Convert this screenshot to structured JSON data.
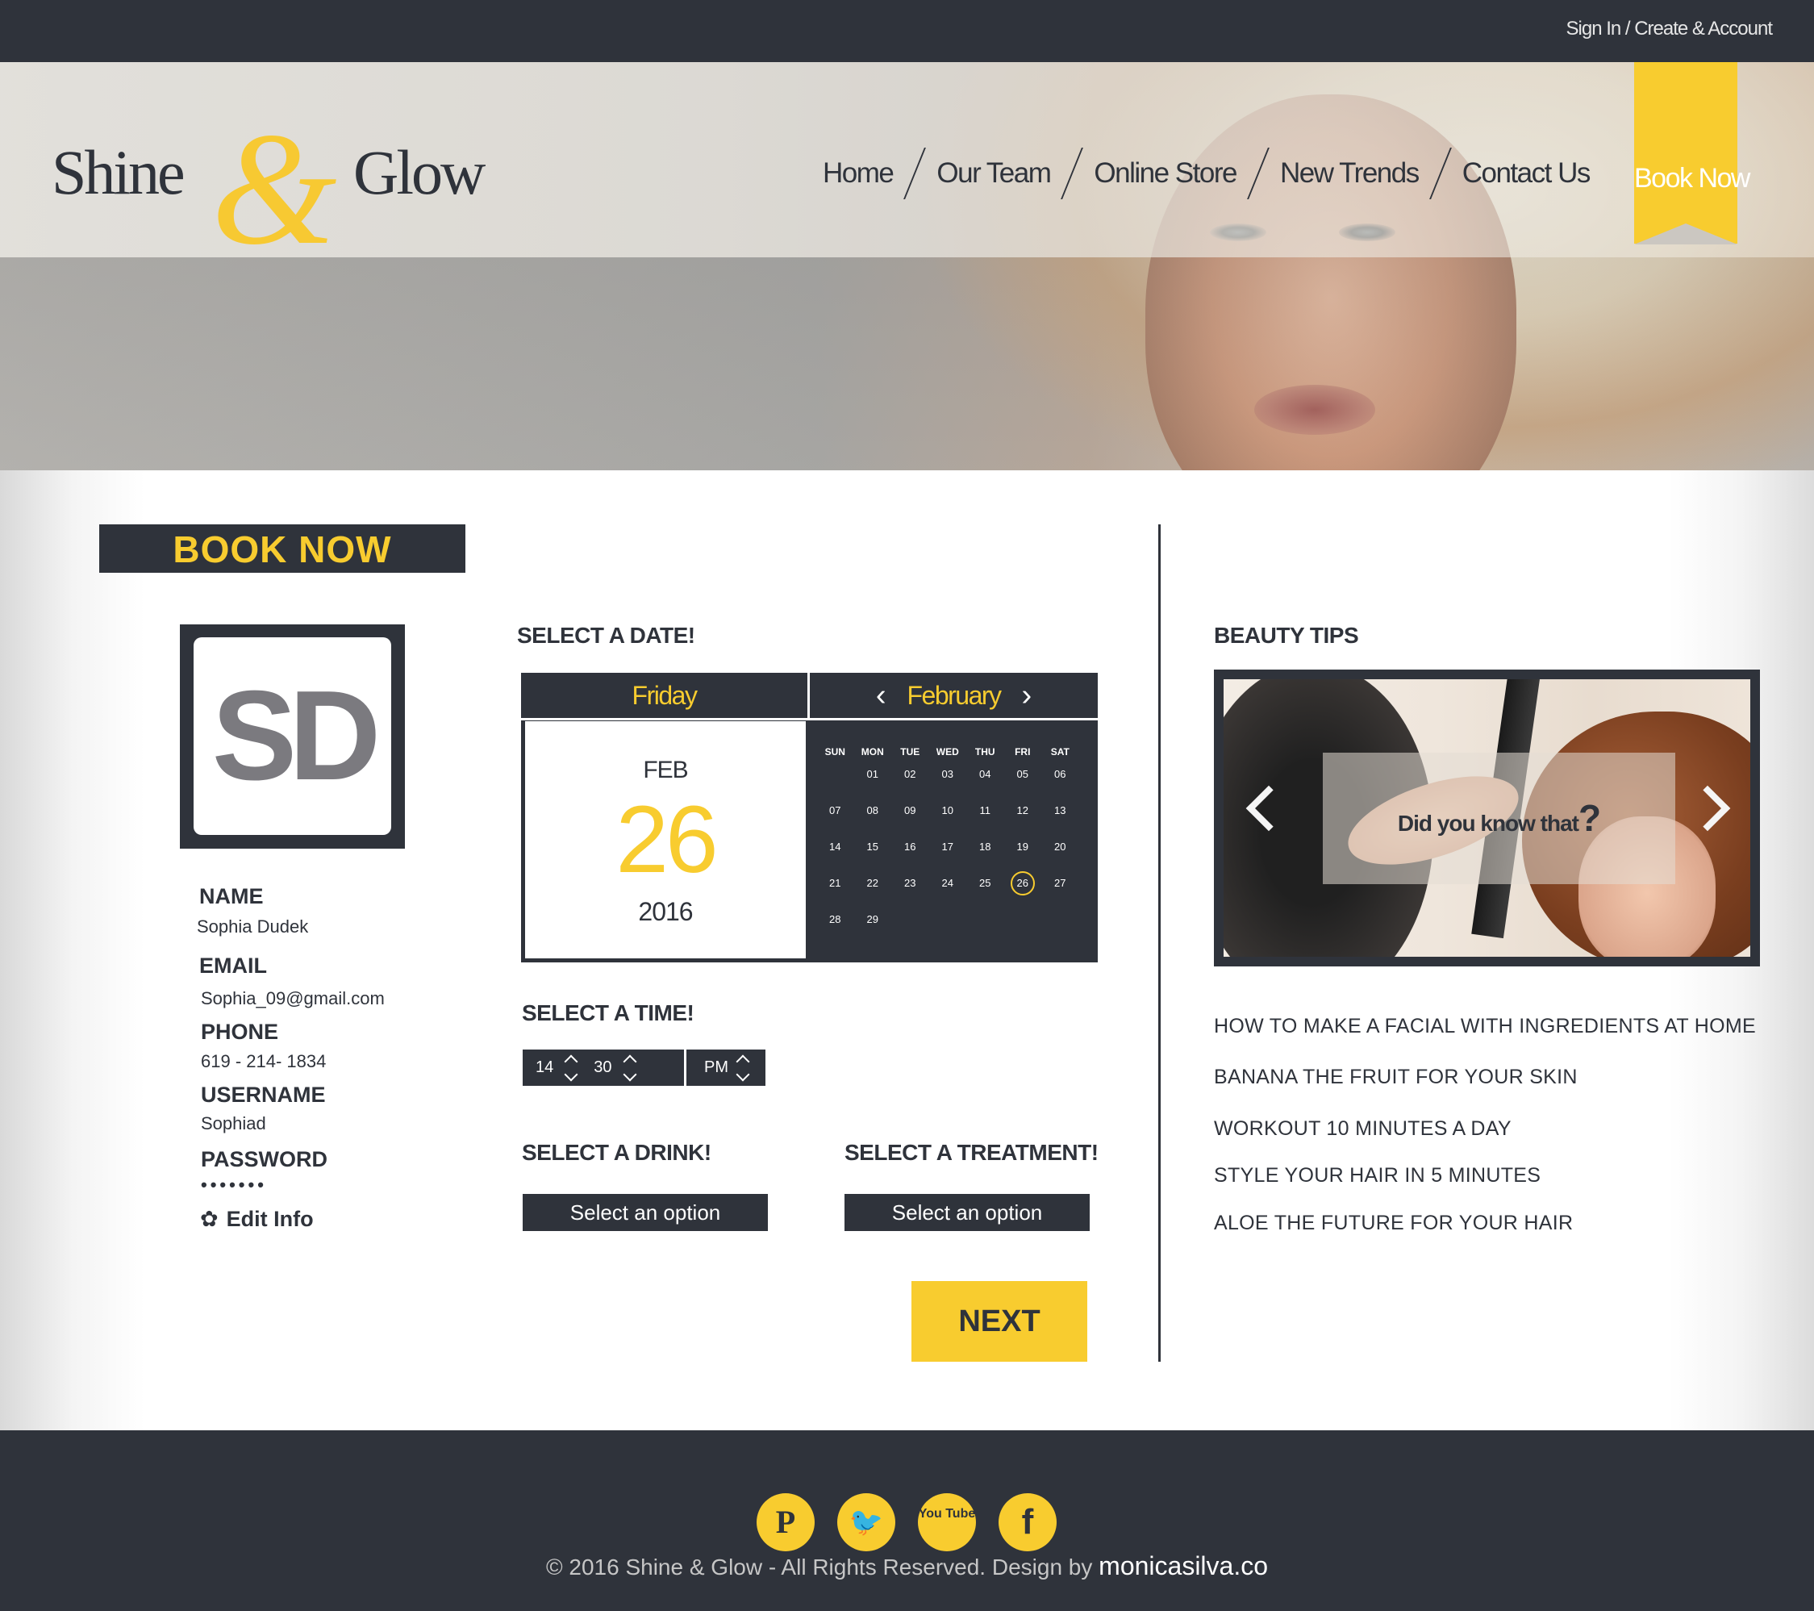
{
  "topbar": {
    "signin": "Sign In / Create & Account"
  },
  "logo": {
    "word1": "Shine",
    "amp": "&",
    "word2": "Glow"
  },
  "nav": {
    "items": [
      "Home",
      "Our Team",
      "Online Store",
      "New Trends",
      "Contact Us"
    ],
    "book_now": "Book Now"
  },
  "colors": {
    "dark": "#2f333b",
    "accent": "#f8cc2f",
    "white": "#ffffff"
  },
  "booking": {
    "title": "BOOK NOW",
    "avatar_initials": "SD",
    "profile": {
      "name_label": "NAME",
      "name": "Sophia Dudek",
      "email_label": "EMAIL",
      "email": "Sophia_09@gmail.com",
      "phone_label": "PHONE",
      "phone": "619 - 214- 1834",
      "username_label": "USERNAME",
      "username": "Sophiad",
      "password_label": "PASSWORD",
      "password": "•••••••",
      "edit_label": "Edit Info"
    },
    "date": {
      "heading": "SELECT A DATE!",
      "weekday": "Friday",
      "month_short": "FEB",
      "day": "26",
      "year": "2016",
      "month": "February",
      "weekdays": [
        "SUN",
        "MON",
        "TUE",
        "WED",
        "THU",
        "FRI",
        "SAT"
      ],
      "weeks": [
        [
          "",
          "01",
          "02",
          "03",
          "04",
          "05",
          "06"
        ],
        [
          "07",
          "08",
          "09",
          "10",
          "11",
          "12",
          "13"
        ],
        [
          "14",
          "15",
          "16",
          "17",
          "18",
          "19",
          "20"
        ],
        [
          "21",
          "22",
          "23",
          "24",
          "25",
          "26",
          "27"
        ],
        [
          "28",
          "29",
          "",
          "",
          "",
          "",
          ""
        ]
      ],
      "selected": "26"
    },
    "time": {
      "heading": "SELECT A TIME!",
      "hour": "14",
      "minute": "30",
      "period": "PM"
    },
    "drink": {
      "heading": "SELECT A DRINK!",
      "placeholder": "Select an option"
    },
    "treatment": {
      "heading": "SELECT A TREATMENT!",
      "placeholder": "Select an option"
    },
    "next_label": "NEXT"
  },
  "tips": {
    "heading": "BEAUTY TIPS",
    "slide_caption": "Did you know that",
    "slide_caption_mark": "?",
    "items": [
      "HOW TO MAKE A FACIAL WITH INGREDIENTS AT HOME",
      "BANANA THE FRUIT FOR YOUR SKIN",
      "WORKOUT 10 MINUTES A DAY",
      "STYLE YOUR HAIR IN 5 MINUTES",
      "ALOE THE FUTURE FOR YOUR HAIR"
    ]
  },
  "footer": {
    "social": [
      {
        "icon": "pinterest-icon",
        "glyph": "P"
      },
      {
        "icon": "twitter-icon",
        "glyph": "🐦"
      },
      {
        "icon": "youtube-icon",
        "glyph": "You Tube"
      },
      {
        "icon": "facebook-icon",
        "glyph": "f"
      }
    ],
    "copyright": "© 2016 Shine & Glow - All Rights Reserved. Design by ",
    "site": "monicasilva.co"
  }
}
